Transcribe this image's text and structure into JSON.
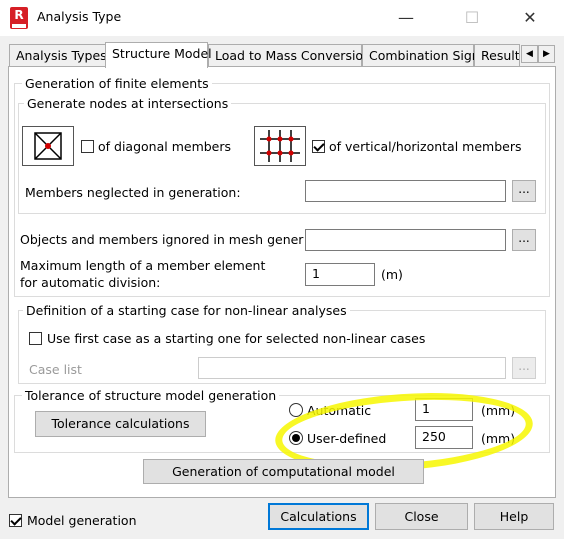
{
  "window": {
    "title": "Analysis Type",
    "app_icon_letter": "R",
    "minimize_glyph": "—",
    "maximize_glyph": "☐",
    "close_glyph": "✕"
  },
  "tabs": [
    {
      "label": "Analysis Types",
      "active": false
    },
    {
      "label": "Structure Model",
      "active": true
    },
    {
      "label": "Load to Mass Conversion",
      "active": false
    },
    {
      "label": "Combination Sign",
      "active": false
    },
    {
      "label": "Result",
      "active": false
    }
  ],
  "tab_scroll": {
    "left": "◀",
    "right": "▶"
  },
  "generation": {
    "group_title": "Generation of finite elements",
    "nodes_group_title": "Generate nodes at intersections",
    "diagonal": {
      "label": "of diagonal members",
      "checked": false
    },
    "vertical_horizontal": {
      "label": "of vertical/horizontal members",
      "checked": true
    },
    "members_neglected_label": "Members neglected in generation:",
    "members_neglected_value": "",
    "objects_ignored_label": "Objects and members ignored in mesh generatior",
    "objects_ignored_value": "",
    "max_length_label_1": "Maximum length of a member element",
    "max_length_label_2": "for automatic division:",
    "max_length_value": "1",
    "max_length_unit": "(m)",
    "browse_label": "..."
  },
  "nonlinear": {
    "group_title": "Definition of a starting case for non-linear analyses",
    "use_first_case": {
      "label": "Use first case as a starting one for selected non-linear cases",
      "checked": false
    },
    "case_list_label": "Case list",
    "case_list_value": ""
  },
  "tolerance": {
    "group_title": "Tolerance of structure model generation",
    "calc_button": "Tolerance calculations",
    "automatic": {
      "label": "Automatic",
      "value": "1",
      "unit": "(mm)",
      "selected": false
    },
    "user_defined": {
      "label": "User-defined",
      "value": "250",
      "unit": "(mm)",
      "selected": true
    }
  },
  "generate_button": "Generation of computational model",
  "footer": {
    "model_generation": {
      "label": "Model generation",
      "checked": true
    },
    "calculations_button": "Calculations",
    "close_button": "Close",
    "help_button": "Help"
  },
  "colors": {
    "highlight": "#f7f700",
    "accent": "#0078d7",
    "node_red": "#d00000"
  }
}
